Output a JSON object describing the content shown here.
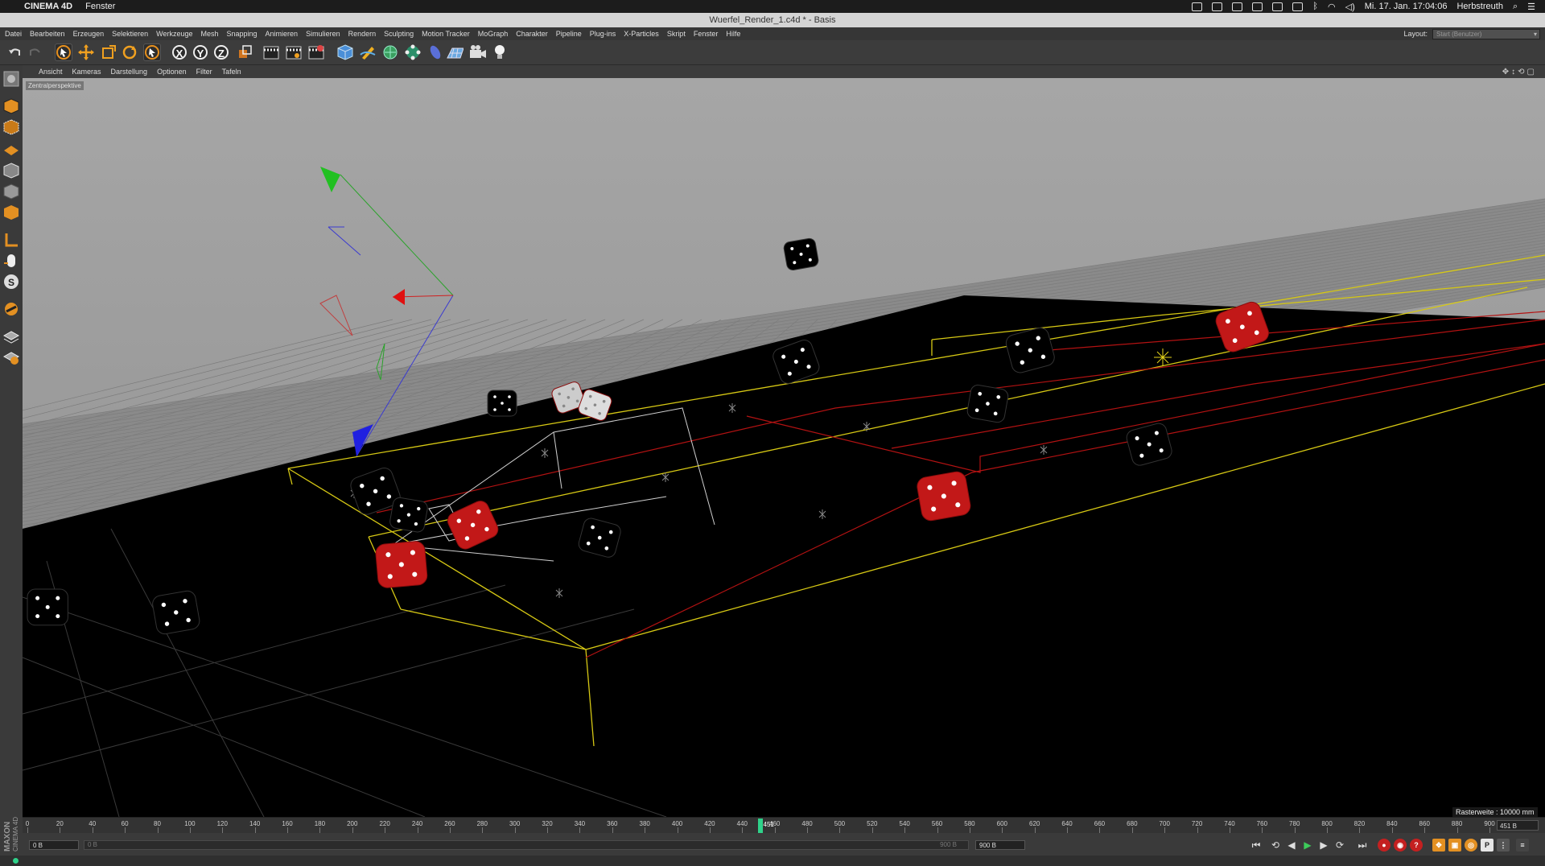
{
  "mac_menubar": {
    "app_name": "CINEMA 4D",
    "menu": "Fenster",
    "datetime": "Mi. 17. Jan.  17:04:06",
    "user": "Herbstreuth"
  },
  "window": {
    "title": "Wuerfel_Render_1.c4d * - Basis"
  },
  "main_menu": [
    "Datei",
    "Bearbeiten",
    "Erzeugen",
    "Selektieren",
    "Werkzeuge",
    "Mesh",
    "Snapping",
    "Animieren",
    "Simulieren",
    "Rendern",
    "Sculpting",
    "Motion Tracker",
    "MoGraph",
    "Charakter",
    "Pipeline",
    "Plug-ins",
    "X-Particles",
    "Skript",
    "Fenster",
    "Hilfe"
  ],
  "layout": {
    "label": "Layout:",
    "value": "Start (Benutzer)"
  },
  "toolbar": {
    "axis_labels": [
      "X",
      "Y",
      "Z"
    ],
    "icons": [
      "undo-icon",
      "redo-icon",
      "live-selection-icon",
      "move-icon",
      "scale-icon",
      "rotate-icon",
      "recent-tool-icon",
      "x-axis-lock-icon",
      "y-axis-lock-icon",
      "z-axis-lock-icon",
      "coordinate-system-icon",
      "render-view-icon",
      "render-picture-viewer-icon",
      "render-settings-icon",
      "cube-icon",
      "pen-icon",
      "subdivision-icon",
      "array-icon",
      "deformer-icon",
      "floor-icon",
      "camera-icon",
      "light-icon"
    ]
  },
  "left_tools": [
    "model-mode-icon",
    "texture-mode-icon",
    "workplane-icon",
    "points-mode-icon",
    "edges-mode-icon",
    "polygons-mode-icon",
    "axis-mode-icon",
    "tweak-icon",
    "snap-icon",
    "magnet-icon",
    "locked-workplane-icon",
    "layer-icon"
  ],
  "viewport": {
    "menu": [
      "Ansicht",
      "Kameras",
      "Darstellung",
      "Optionen",
      "Filter",
      "Tafeln"
    ],
    "camera_label": "Zentralperspektive",
    "grid_info": "Rasterweite : 10000 mm",
    "colors": {
      "sky": "#a0a0a0",
      "floor": "#000000",
      "wire_yellow": "#d6c814",
      "wire_red": "#b31212"
    }
  },
  "timeline": {
    "ticks": [
      "0",
      "20",
      "40",
      "60",
      "80",
      "100",
      "120",
      "140",
      "160",
      "180",
      "200",
      "220",
      "240",
      "260",
      "280",
      "300",
      "320",
      "340",
      "360",
      "380",
      "400",
      "420",
      "440",
      "460",
      "480",
      "500",
      "520",
      "540",
      "560",
      "580",
      "600",
      "620",
      "640",
      "660",
      "680",
      "700",
      "720",
      "740",
      "760",
      "780",
      "800",
      "820",
      "840",
      "860",
      "880",
      "900"
    ],
    "current_frame": "451",
    "playhead_tick": "0",
    "end_display": "451 B",
    "start_field": "0 B",
    "min_field": "0 B",
    "max_field": "900 B",
    "end_field": "900 B"
  },
  "logo": {
    "line1": "MAXON",
    "line2": "CINEMA 4D"
  }
}
